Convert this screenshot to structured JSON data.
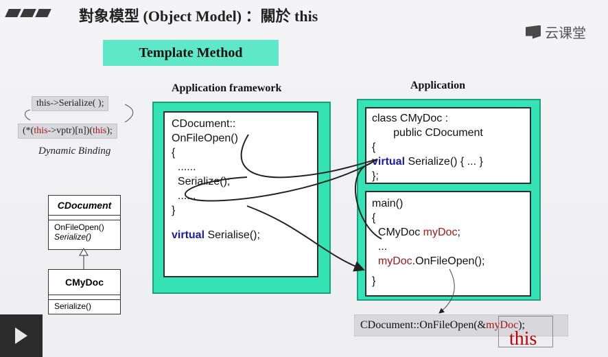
{
  "header": {
    "title": "對象模型 (Object Model) ：關於 this",
    "logo_text": "云课堂"
  },
  "banner": {
    "label": "Template Method"
  },
  "columns": {
    "framework_caption": "Application framework",
    "application_caption": "Application"
  },
  "framework_code": {
    "l1": "CDocument::",
    "l2": "OnFileOpen()",
    "l3": "{",
    "l4": "  ......",
    "l5": "  Serialize();",
    "l6": "  ......",
    "l7": "}",
    "kw_virtual": "virtual",
    "l8_rest": " Serialise();"
  },
  "class_code": {
    "l1": "class CMyDoc :",
    "l2": "       public CDocument",
    "l3": "{",
    "kw_virtual": "virtual",
    "l4_rest": " Serialize() { ... }",
    "l5": "};"
  },
  "main_code": {
    "l1": "main()",
    "l2": "{",
    "l3a": "  CMyDoc ",
    "l3b": "myDoc",
    "l3c": ";",
    "l4": "  ...",
    "l5a": "  myDoc",
    "l5b": ".OnFileOpen();",
    "l6": "}"
  },
  "notes": {
    "serialize_call": "this->Serialize( );",
    "dyn_open": "(*(",
    "dyn_this": "this",
    "dyn_mid": "->vptr)[n])(",
    "dyn_this2": "this",
    "dyn_close": ");",
    "dynamic_binding": "Dynamic Binding"
  },
  "uml": {
    "base_name": "CDocument",
    "base_m1": "OnFileOpen()",
    "base_m2": "Serialize()",
    "derived_name": "CMyDoc",
    "derived_m1": "Serialize()"
  },
  "bottom": {
    "call_prefix": "CDocument::OnFileOpen(&",
    "call_arg": "myDoc",
    "call_suffix": " );",
    "this_label": "this"
  },
  "colors": {
    "accent_green": "#35e2b4",
    "banner_green": "#5ee8c8",
    "keyword_blue": "#1a1aa8",
    "highlight_red": "#a01818",
    "this_red": "#c00000"
  }
}
